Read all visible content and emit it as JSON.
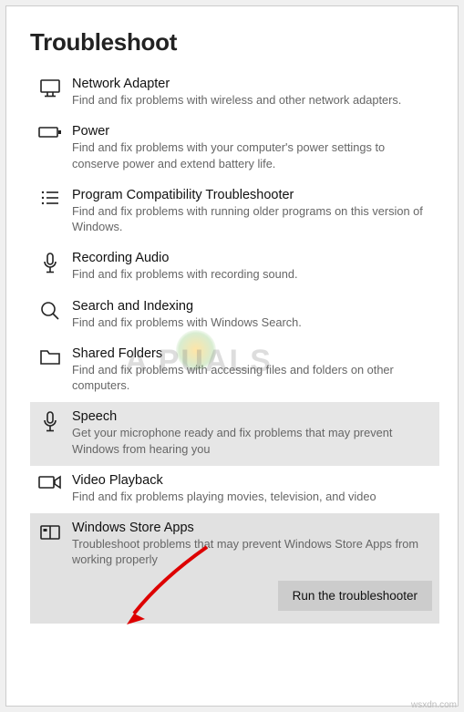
{
  "page_title": "Troubleshoot",
  "items": [
    {
      "icon": "monitor-icon",
      "title": "Network Adapter",
      "desc": "Find and fix problems with wireless and other network adapters."
    },
    {
      "icon": "battery-icon",
      "title": "Power",
      "desc": "Find and fix problems with your computer's power settings to conserve power and extend battery life."
    },
    {
      "icon": "list-icon",
      "title": "Program Compatibility Troubleshooter",
      "desc": "Find and fix problems with running older programs on this version of Windows."
    },
    {
      "icon": "microphone-icon",
      "title": "Recording Audio",
      "desc": "Find and fix problems with recording sound."
    },
    {
      "icon": "search-icon",
      "title": "Search and Indexing",
      "desc": "Find and fix problems with Windows Search."
    },
    {
      "icon": "folder-icon",
      "title": "Shared Folders",
      "desc": "Find and fix problems with accessing files and folders on other computers."
    },
    {
      "icon": "microphone-icon",
      "title": "Speech",
      "desc": "Get your microphone ready and fix problems that may prevent Windows from hearing you",
      "selected": true
    },
    {
      "icon": "video-icon",
      "title": "Video Playback",
      "desc": "Find and fix problems playing movies, television, and video"
    },
    {
      "icon": "store-icon",
      "title": "Windows Store Apps",
      "desc": "Troubleshoot problems that may prevent Windows Store Apps from working properly",
      "expanded": true
    }
  ],
  "run_button_label": "Run the troubleshooter",
  "watermark_text": "A   PUALS",
  "footer_credit": "wsxdn.com"
}
